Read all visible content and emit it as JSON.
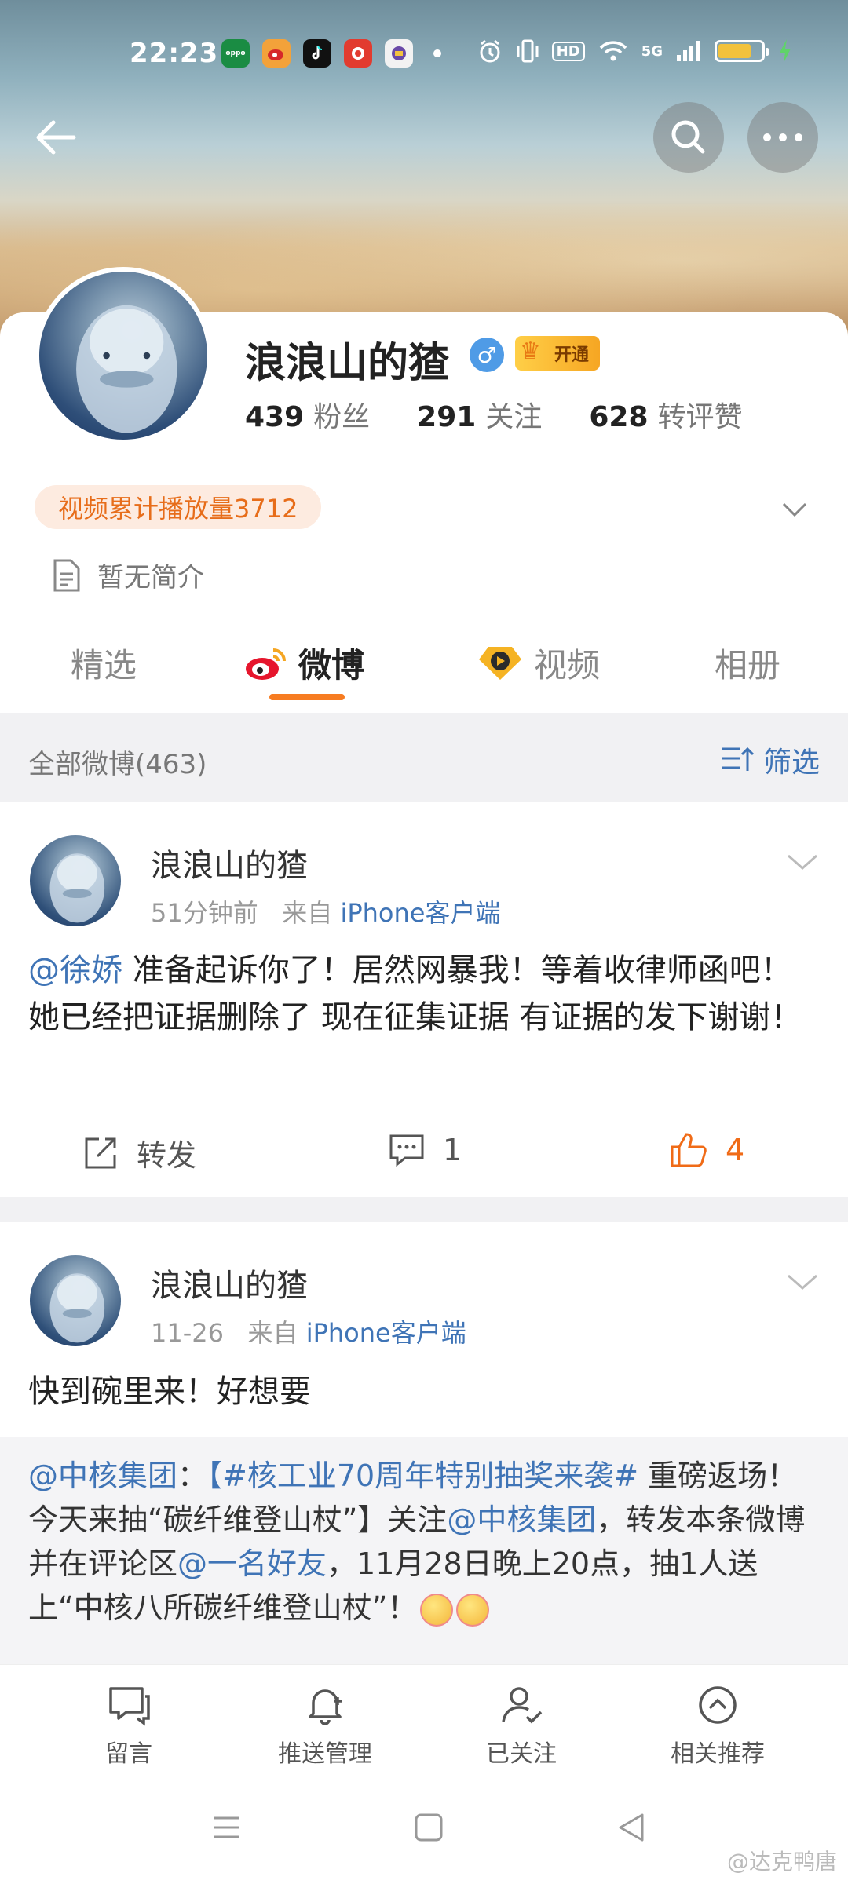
{
  "status_bar": {
    "time": "22:23",
    "network": "5G",
    "hd": "HD",
    "battery_level": 0.75,
    "apps": [
      {
        "icon": "oppo-app-icon",
        "label": "oppo",
        "color": "#1a8c43"
      },
      {
        "icon": "weibo-app-icon",
        "label": "",
        "color": "#f3a23a"
      },
      {
        "icon": "tiktok-app-icon",
        "label": "",
        "color": "#111111"
      },
      {
        "icon": "game-app-icon",
        "label": "",
        "color": "#e23b2f"
      },
      {
        "icon": "game2-app-icon",
        "label": "",
        "color": "#f2f2f2"
      }
    ]
  },
  "profile": {
    "name": "浪浪山的猹",
    "gender_symbol": "♂",
    "vip_label": "开通",
    "stats": [
      {
        "num": "439",
        "label": "粉丝"
      },
      {
        "num": "291",
        "label": "关注"
      },
      {
        "num": "628",
        "label": "转评赞"
      }
    ],
    "video_plays": "视频累计播放量3712",
    "bio": "暂无简介"
  },
  "tabs": [
    {
      "label": "精选",
      "active": false
    },
    {
      "label": "微博",
      "active": true
    },
    {
      "label": "视频",
      "active": false
    },
    {
      "label": "相册",
      "active": false
    }
  ],
  "filter": {
    "count_label": "全部微博(463)",
    "filter_label": "筛选"
  },
  "posts": [
    {
      "author": "浪浪山的猹",
      "time": "51分钟前",
      "from_prefix": "来自",
      "source": "iPhone客户端",
      "mention": "@徐娇",
      "text": " 准备起诉你了！居然网暴我！等着收律师函吧！她已经把证据删除了 现在征集证据 有证据的发下谢谢！",
      "repost_label": "转发",
      "comment_count": "1",
      "like_count": "4"
    },
    {
      "author": "浪浪山的猹",
      "time": "11-26",
      "from_prefix": "来自",
      "source": "iPhone客户端",
      "text": "快到碗里来！好想要",
      "repost": {
        "m1": "@中核集团",
        "t1": "：",
        "m2": "【#核工业70周年特别抽奖来袭#",
        "t2": " 重磅返场！今天来抽“碳纤维登山杖”】关注",
        "m3": "@中核集团",
        "t3": "，转发本条微博并在评论区",
        "m4": "@一名好友",
        "t4": "，11月28日晚上20点，抽1人送上“中核八所碳纤维登山杖”！"
      }
    }
  ],
  "bottom_bar": [
    {
      "label": "留言",
      "icon": "message-icon"
    },
    {
      "label": "推送管理",
      "icon": "bell-plus-icon"
    },
    {
      "label": "已关注",
      "icon": "user-check-icon"
    },
    {
      "label": "相关推荐",
      "icon": "chevron-up-circle-icon"
    }
  ],
  "watermark": "@达克鸭唐",
  "colors": {
    "accent_orange": "#f77c21",
    "link_blue": "#3f74b6"
  }
}
